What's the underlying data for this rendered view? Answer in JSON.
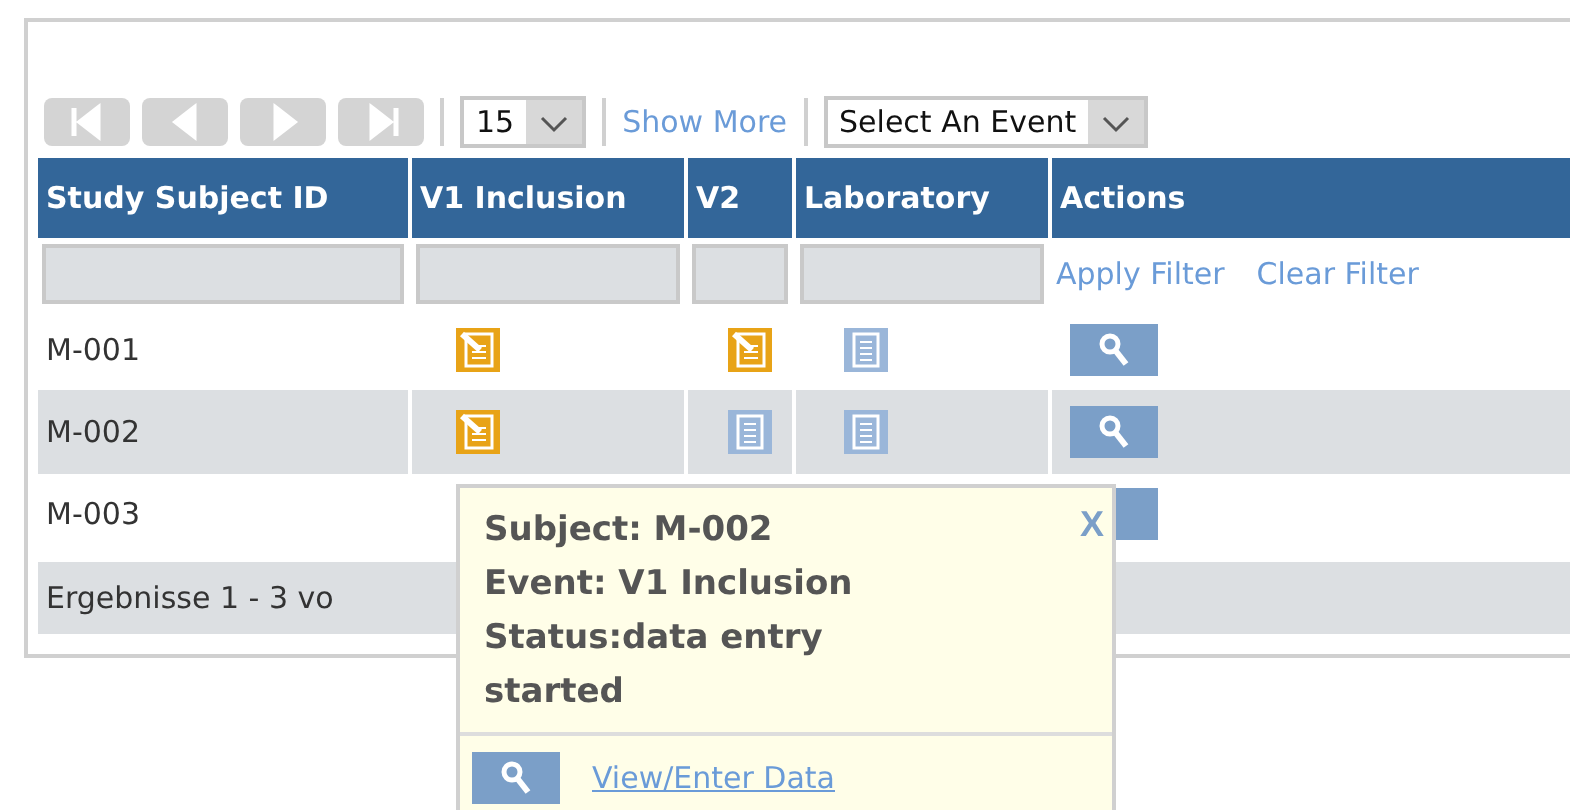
{
  "toolbar": {
    "nav_buttons": [
      {
        "kind": "first",
        "disabled": true
      },
      {
        "kind": "prev",
        "disabled": true
      },
      {
        "kind": "next",
        "disabled": true
      },
      {
        "kind": "last",
        "disabled": true
      }
    ],
    "page_size": "15",
    "show_more": "Show More",
    "event_select": "Select An Event"
  },
  "table": {
    "columns": [
      "Study Subject ID",
      "V1 Inclusion",
      "V2",
      "Laboratory",
      "Actions"
    ],
    "filter_links": [
      "Apply Filter",
      "Clear Filter"
    ],
    "rows": [
      {
        "id": "M-001",
        "selected": false,
        "events": [
          {
            "started": true
          },
          {
            "started": true
          },
          {
            "started": false
          }
        ]
      },
      {
        "id": "M-002",
        "selected": true,
        "events": [
          {
            "started": true
          },
          {
            "started": false
          },
          {
            "started": false
          }
        ]
      },
      {
        "id": "M-003",
        "selected": false
      }
    ],
    "footer": "Ergebnisse 1 - 3 vo"
  },
  "popup": {
    "lines": [
      "Subject: M-002",
      "Event: V1 Inclusion",
      "Status:data entry started"
    ],
    "close": "X",
    "link": "View/Enter Data"
  }
}
